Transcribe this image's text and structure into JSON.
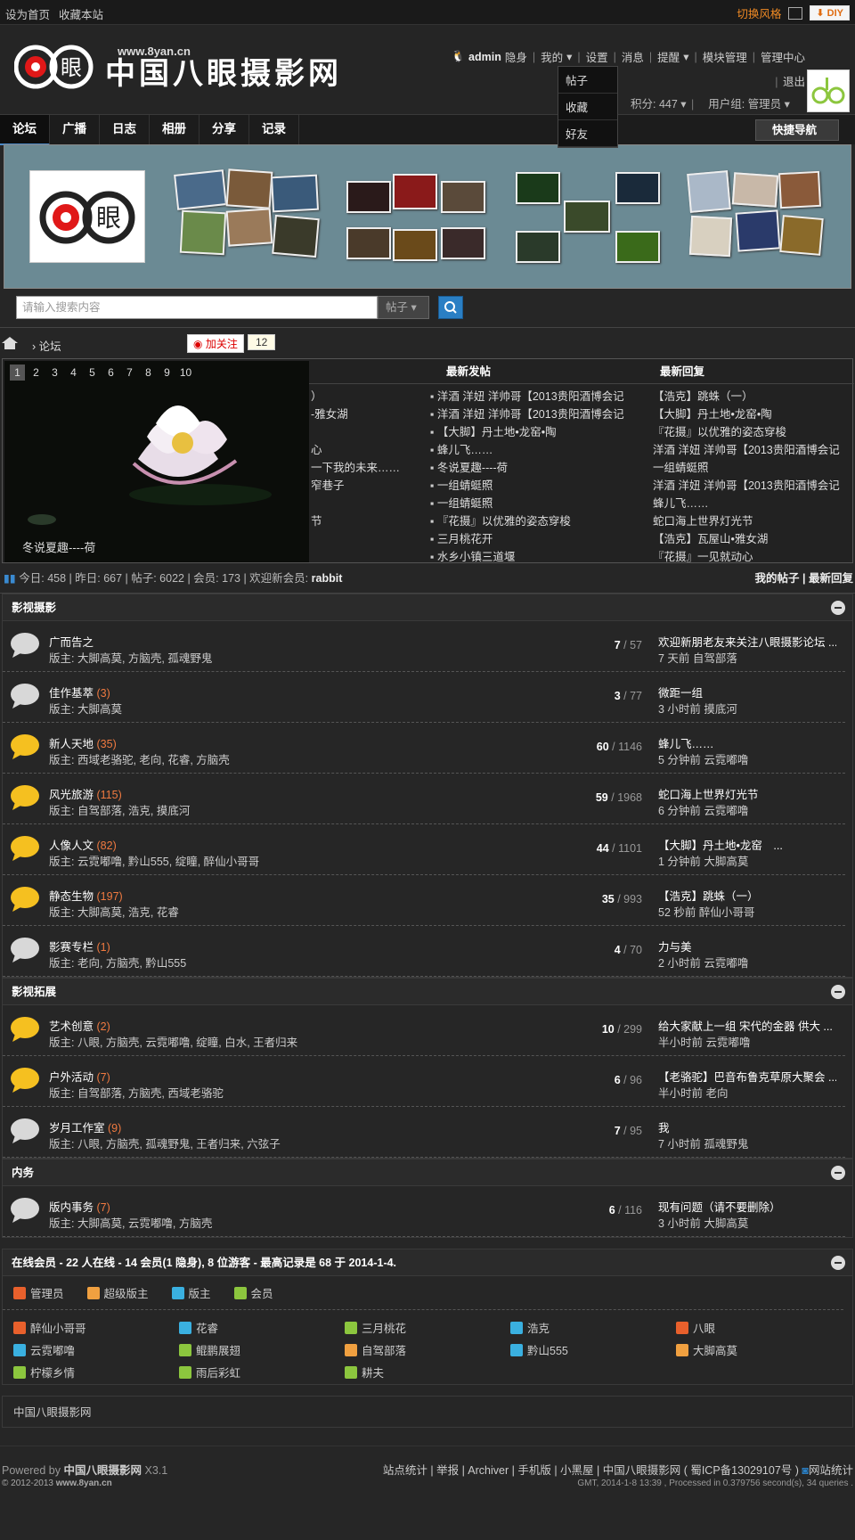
{
  "topbar": {
    "set_home": "设为首页",
    "bookmark": "收藏本站",
    "switch_style": "切换风格",
    "diy": "DIY"
  },
  "header": {
    "site_url": "www.8yan.cn",
    "site_name": "中国八眼摄影网",
    "username": "admin",
    "hide": "隐身",
    "mine": "我的",
    "settings": "设置",
    "messages": "消息",
    "remind": "提醒",
    "modules": "模块管理",
    "admin": "管理中心",
    "logout": "退出",
    "points": "积分: 447",
    "usergroup": "用户组: 管理员",
    "dropdown": [
      "帖子",
      "收藏",
      "好友"
    ]
  },
  "nav": {
    "tabs": [
      "论坛",
      "广播",
      "日志",
      "相册",
      "分享",
      "记录"
    ],
    "quick": "快捷导航"
  },
  "search": {
    "placeholder": "请输入搜索内容",
    "type": "帖子"
  },
  "crumb": {
    "forum": "论坛",
    "follow": "加关注",
    "follow_count": "12"
  },
  "latest": {
    "slide_nums": [
      "1",
      "2",
      "3",
      "4",
      "5",
      "6",
      "7",
      "8",
      "9",
      "10"
    ],
    "slide_caption": "冬说夏趣----荷",
    "hidden_col": [
      "）",
      "-雅女湖",
      "",
      "心",
      "一下我的未来……",
      "窄巷子",
      "",
      "节"
    ],
    "new_title": "最新发帖",
    "new_posts": [
      "洋酒 洋妞 洋帅哥【2013贵阳酒博会记",
      "洋酒 洋妞 洋帅哥【2013贵阳酒博会记",
      "【大脚】丹土地•龙窑•陶",
      "蜂儿飞……",
      "冬说夏趣----荷",
      "一组蜻蜓照",
      "一组蜻蜓照",
      "『花摄』以优雅的姿态穿梭",
      "三月桃花开",
      "水乡小镇三道堰"
    ],
    "reply_title": "最新回复",
    "new_replies": [
      "【浩克】跳蛛（一）",
      "【大脚】丹土地•龙窑•陶",
      "『花摄』以优雅的姿态穿梭",
      "洋酒 洋妞 洋帅哥【2013贵阳酒博会记",
      "一组蜻蜓照",
      "洋酒 洋妞 洋帅哥【2013贵阳酒博会记",
      "蜂儿飞……",
      "蛇口海上世界灯光节",
      "【浩克】瓦屋山•雅女湖",
      "『花摄』一见就动心"
    ]
  },
  "stats": {
    "text": "今日: 458 | 昨日: 667 | 帖子: 6022 | 会员: 173 | 欢迎新会员: ",
    "newest": "rabbit",
    "my_posts": "我的帖子",
    "recent": "最新回复"
  },
  "sections": [
    {
      "title": "影视摄影",
      "forums": [
        {
          "name": "广而告之",
          "today": "",
          "mods": "版主: 大脚高莫, 方脑壳, 孤魂野鬼",
          "threads": "7",
          "posts": "57",
          "last": "欢迎新朋老友来关注八眼摄影论坛 ...",
          "time": "7 天前 自驾部落",
          "hot": false
        },
        {
          "name": "佳作基萃",
          "today": "(3)",
          "mods": "版主: 大脚高莫",
          "threads": "3",
          "posts": "77",
          "last": "微距一组",
          "time": "3 小时前 摸底河",
          "hot": false
        },
        {
          "name": "新人天地",
          "today": "(35)",
          "mods": "版主: 西域老骆驼, 老向, 花睿, 方脑壳",
          "threads": "60",
          "posts": "1146",
          "last": "蜂儿飞……",
          "time": "5 分钟前 云霓嘟噜",
          "hot": true
        },
        {
          "name": "风光旅游",
          "today": "(115)",
          "mods": "版主: 自驾部落, 浩克, 摸底河",
          "threads": "59",
          "posts": "1968",
          "last": "蛇口海上世界灯光节",
          "time": "6 分钟前 云霓嘟噜",
          "hot": true
        },
        {
          "name": "人像人文",
          "today": "(82)",
          "mods": "版主: 云霓嘟噜, 黔山555, 绽瞳, 醉仙小哥哥",
          "threads": "44",
          "posts": "1101",
          "last": "【大脚】丹土地•龙窑　...",
          "time": "1 分钟前 大脚高莫",
          "hot": true
        },
        {
          "name": "静态生物",
          "today": "(197)",
          "mods": "版主: 大脚高莫, 浩克, 花睿",
          "threads": "35",
          "posts": "993",
          "last": "【浩克】跳蛛（一）",
          "time": "52 秒前 醉仙小哥哥",
          "hot": true
        },
        {
          "name": "影赛专栏",
          "today": "(1)",
          "mods": "版主: 老向, 方脑壳, 黔山555",
          "threads": "4",
          "posts": "70",
          "last": "力与美",
          "time": "2 小时前 云霓嘟噜",
          "hot": false
        }
      ]
    },
    {
      "title": "影视拓展",
      "forums": [
        {
          "name": "艺术创意",
          "today": "(2)",
          "mods": "版主: 八眼, 方脑壳, 云霓嘟噜, 绽瞳, 白水, 王者归来",
          "threads": "10",
          "posts": "299",
          "last": "给大家献上一组 宋代的金器 供大 ...",
          "time": "半小时前 云霓嘟噜",
          "hot": true
        },
        {
          "name": "户外活动",
          "today": "(7)",
          "mods": "版主: 自驾部落, 方脑壳, 西域老骆驼",
          "threads": "6",
          "posts": "96",
          "last": "【老骆驼】巴音布鲁克草原大聚会 ...",
          "time": "半小时前 老向",
          "hot": true
        },
        {
          "name": "岁月工作室",
          "today": "(9)",
          "mods": "版主: 八眼, 方脑壳, 孤魂野鬼, 王者归来, 六弦子",
          "threads": "7",
          "posts": "95",
          "last": "我",
          "time": "7 小时前 孤魂野鬼",
          "hot": false
        }
      ]
    },
    {
      "title": "内务",
      "forums": [
        {
          "name": "版内事务",
          "today": "(7)",
          "mods": "版主: 大脚高莫, 云霓嘟噜, 方脑壳",
          "threads": "6",
          "posts": "116",
          "last": "现有问题（请不要删除）",
          "time": "3 小时前 大脚高莫",
          "hot": false
        }
      ]
    }
  ],
  "online": {
    "title": "在线会员 - 22 人在线 - 14 会员(1 隐身), 8 位游客 - 最高记录是 68 于 2014-1-4.",
    "legend": [
      "管理员",
      "超级版主",
      "版主",
      "会员"
    ],
    "members": [
      {
        "n": "醉仙小哥哥",
        "c": "#e8602c"
      },
      {
        "n": "花睿",
        "c": "#3ab0e0"
      },
      {
        "n": "三月桃花",
        "c": "#8cc63e"
      },
      {
        "n": "浩克",
        "c": "#3ab0e0"
      },
      {
        "n": "八眼",
        "c": "#e8602c"
      },
      {
        "n": "云霓嘟噜",
        "c": "#3ab0e0"
      },
      {
        "n": "鲲鹏展翅",
        "c": "#8cc63e"
      },
      {
        "n": "自驾部落",
        "c": "#f0a040"
      },
      {
        "n": "黔山555",
        "c": "#3ab0e0"
      },
      {
        "n": "大脚高莫",
        "c": "#f0a040"
      },
      {
        "n": "柠檬乡情",
        "c": "#8cc63e"
      },
      {
        "n": "雨后彩虹",
        "c": "#8cc63e"
      },
      {
        "n": "耕夫",
        "c": "#8cc63e"
      }
    ]
  },
  "footer": {
    "site": "中国八眼摄影网",
    "powered_by": "Powered by",
    "version": "X3.1",
    "copyright": "© 2012-2013",
    "site_url": "www.8yan.cn",
    "links": "站点统计 | 举报 | Archiver | 手机版 | 小黑屋 | 中国八眼摄影网 ( 蜀ICP备13029107号 )",
    "stat": "网站统计",
    "gmt": "GMT, 2014-1-8 13:39 , Processed in 0.379756 second(s), 34 queries ."
  }
}
